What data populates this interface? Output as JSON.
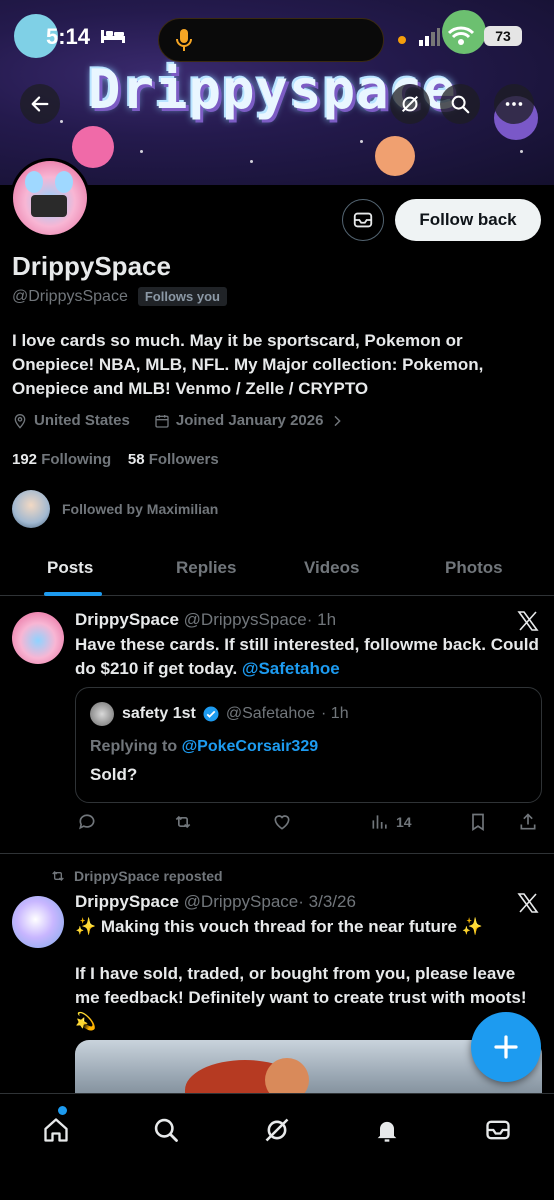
{
  "status_bar": {
    "time": "5:14",
    "battery": "73"
  },
  "banner": {
    "title": "Drippyspace"
  },
  "profile": {
    "display_name": "DrippySpace",
    "handle": "@DrippysSpace",
    "follows_you": "Follows you",
    "follow_back_label": "Follow back",
    "bio": "I love cards so much. May it be sportscard, Pokemon or Onepiece! NBA, MLB, NFL. My Major collection: Pokemon, Onepiece and MLB! Venmo / Zelle / CRYPTO",
    "location": "United States",
    "joined": "Joined January 2026",
    "following_count": "192",
    "following_label": "Following",
    "followers_count": "58",
    "followers_label": "Followers",
    "followed_by": "Followed by Maximilian"
  },
  "tabs": [
    {
      "label": "Posts"
    },
    {
      "label": "Replies"
    },
    {
      "label": "Videos"
    },
    {
      "label": "Photos"
    }
  ],
  "posts": [
    {
      "name": "DrippySpace",
      "handle": "@DrippysSpace",
      "time": "· 1h",
      "text_before": "Have these cards. If still interested, followme back. Could do $210 if get today. ",
      "mention": "@Safetahoe",
      "quote": {
        "name": "safety 1st",
        "handle": "@Safetahoe",
        "time": "· 1h",
        "replying_prefix": "Replying to ",
        "replying_to": "@PokeCorsair329",
        "text": "Sold?"
      },
      "views": "14"
    },
    {
      "repost_label": "DrippySpace reposted",
      "name": "DrippySpace",
      "handle": "@DrippySpace",
      "time": "· 3/3/26",
      "line1": "✨ Making this vouch thread for the near future ✨",
      "line2": "If I have sold, traded, or bought from you, please leave me feedback! Definitely want to create trust with moots! 💫"
    }
  ],
  "colors": {
    "accent": "#1d9bf0",
    "background": "#000000",
    "muted": "#71767b"
  }
}
